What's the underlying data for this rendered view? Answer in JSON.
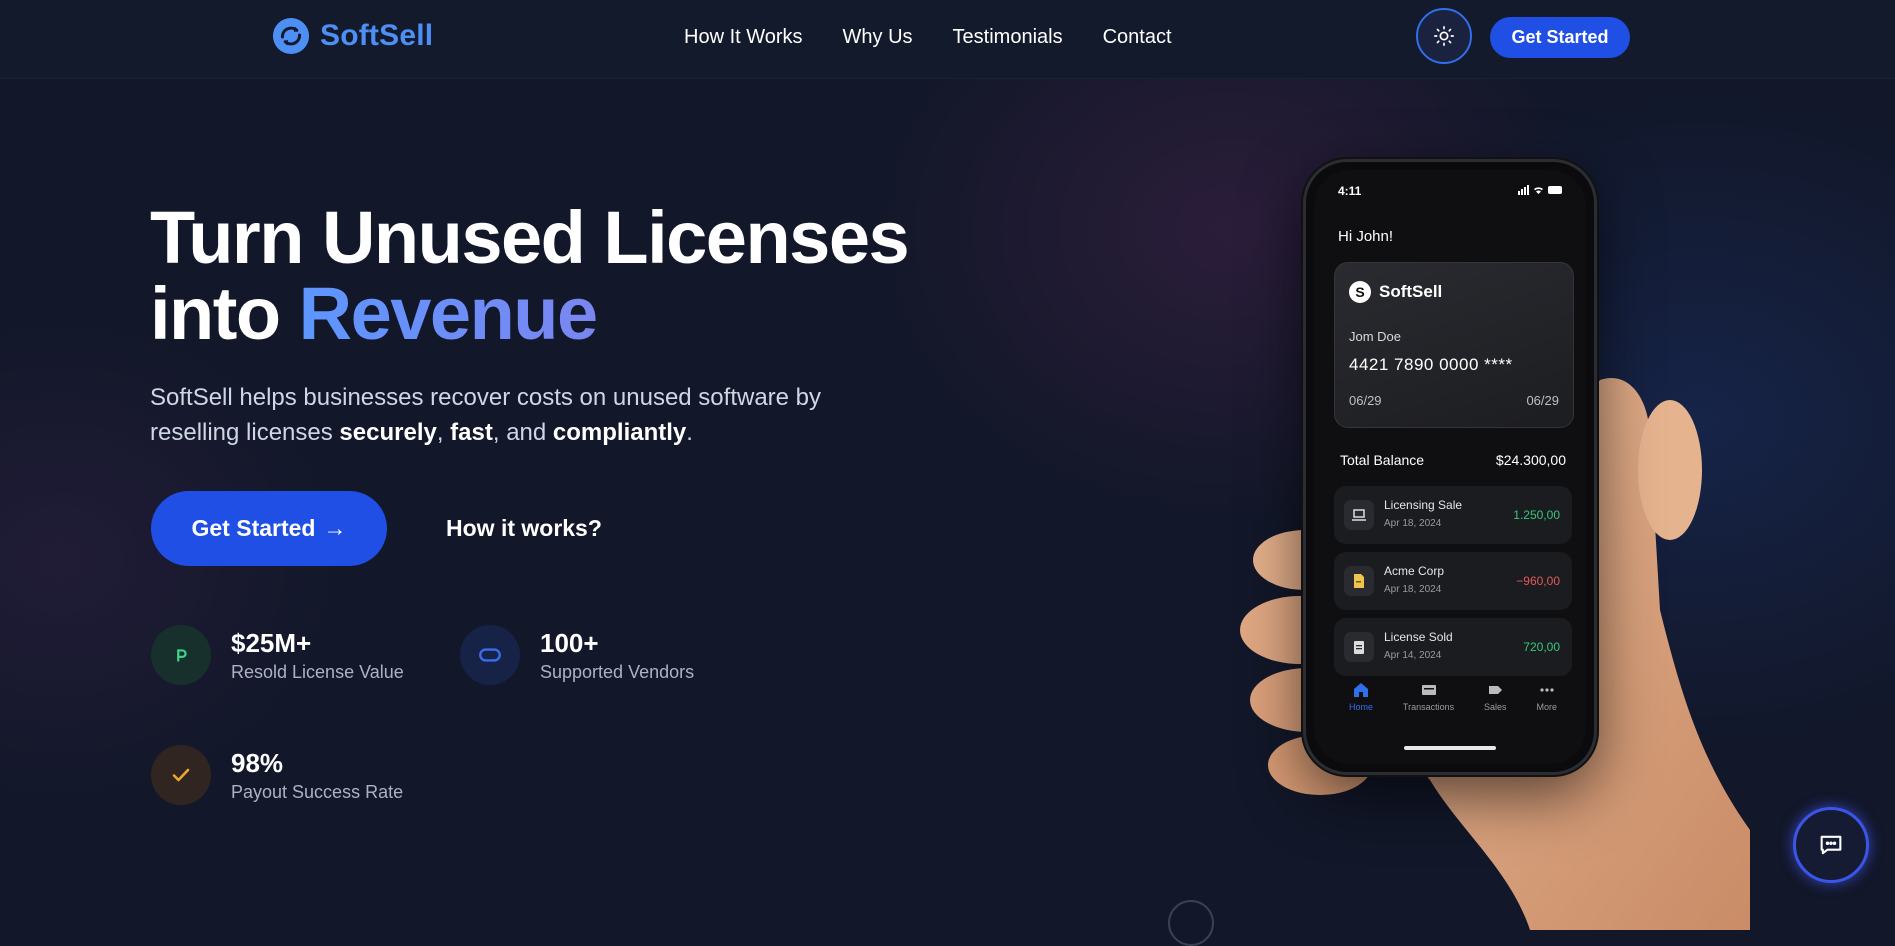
{
  "brand": {
    "name": "SoftSell"
  },
  "nav": {
    "items": [
      {
        "label": "How It Works"
      },
      {
        "label": "Why Us"
      },
      {
        "label": "Testimonials"
      },
      {
        "label": "Contact"
      }
    ],
    "cta_label": "Get Started",
    "theme_toggle_icon": "sun-icon"
  },
  "hero": {
    "title_line1": "Turn Unused Licenses",
    "title_line2_prefix": "into ",
    "title_line2_highlight": "Revenue",
    "subtitle_part1": "SoftSell helps businesses recover costs on unused software by reselling licenses ",
    "subtitle_bold1": "securely",
    "subtitle_sep1": ", ",
    "subtitle_bold2": "fast",
    "subtitle_sep2": ", and ",
    "subtitle_bold3": "compliantly",
    "subtitle_end": ".",
    "primary_cta": "Get Started",
    "primary_cta_arrow": "→",
    "secondary_cta": "How it works?"
  },
  "stats": [
    {
      "value": "$25M+",
      "label": "Resold License Value",
      "icon": "currency-icon",
      "color": "#3dd68c"
    },
    {
      "value": "100+",
      "label": "Supported Vendors",
      "icon": "vendors-icon",
      "color": "#3b6cf0"
    },
    {
      "value": "98%",
      "label": "Payout Success Rate",
      "icon": "check-icon",
      "color": "#f0a531"
    }
  ],
  "phone": {
    "time": "4:11",
    "greeting": "Hi John!",
    "card": {
      "brand": "SoftSell",
      "holder": "Jom Doe",
      "number": "4421 7890 0000 ****",
      "exp_left": "06/29",
      "exp_right": "06/29"
    },
    "balance_label": "Total Balance",
    "balance_value": "$24.300,00",
    "transactions": [
      {
        "title": "Licensing Sale",
        "date": "Apr 18, 2024",
        "amount": "1.250,00",
        "type": "positive"
      },
      {
        "title": "Acme Corp",
        "date": "Apr 18, 2024",
        "amount": "−960,00",
        "type": "negative"
      },
      {
        "title": "License Sold",
        "date": "Apr 14, 2024",
        "amount": "720,00",
        "type": "positive"
      }
    ],
    "tabs": [
      {
        "label": "Home",
        "active": true
      },
      {
        "label": "Transactions"
      },
      {
        "label": "Sales"
      },
      {
        "label": "More"
      }
    ]
  },
  "colors": {
    "accent": "#1f4fe5",
    "brand_blue": "#4d8ff5",
    "background": "#121729"
  }
}
